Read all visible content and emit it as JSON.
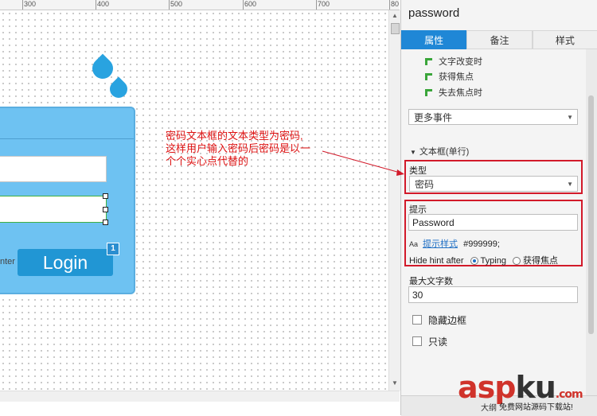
{
  "ruler": {
    "labels": [
      "300",
      "400",
      "500",
      "600",
      "700",
      "80"
    ]
  },
  "canvas": {
    "login_button_label": "Login",
    "badge_number": "1",
    "enter_fragment": "nter",
    "annotation_lines": [
      "密码文本框的文本类型为密码,",
      "这样用户输入密码后密码是以一",
      "个个实心点代替的"
    ]
  },
  "panel": {
    "title": "password",
    "tabs": [
      "属性",
      "备注",
      "样式"
    ],
    "active_tab": 0,
    "events": [
      "文字改变时",
      "获得焦点",
      "失去焦点时"
    ],
    "more_events": "更多事件",
    "section_title": "文本框(单行)",
    "type_label": "类型",
    "type_value": "密码",
    "hint_label": "提示",
    "hint_value": "Password",
    "hint_style_icon": "Aa",
    "hint_style_link": "提示样式",
    "hint_style_color": "#999999;",
    "hide_hint_label": "Hide hint after",
    "hide_hint_options": [
      "Typing",
      "获得焦点"
    ],
    "hide_hint_selected": 0,
    "max_length_label": "最大文字数",
    "max_length_value": "30",
    "hide_border_label": "隐藏边框",
    "readonly_label": "只读",
    "bottom_fragment": "大纲"
  },
  "watermark": {
    "part1": "asp",
    "part2": "ku",
    "part3": ".com",
    "sub": "免费网站源码下载站!"
  },
  "colors": {
    "accent": "#1f87d6",
    "highlight": "#d21a2a",
    "login_panel": "#6ec2f2",
    "login_button": "#2196d4"
  }
}
